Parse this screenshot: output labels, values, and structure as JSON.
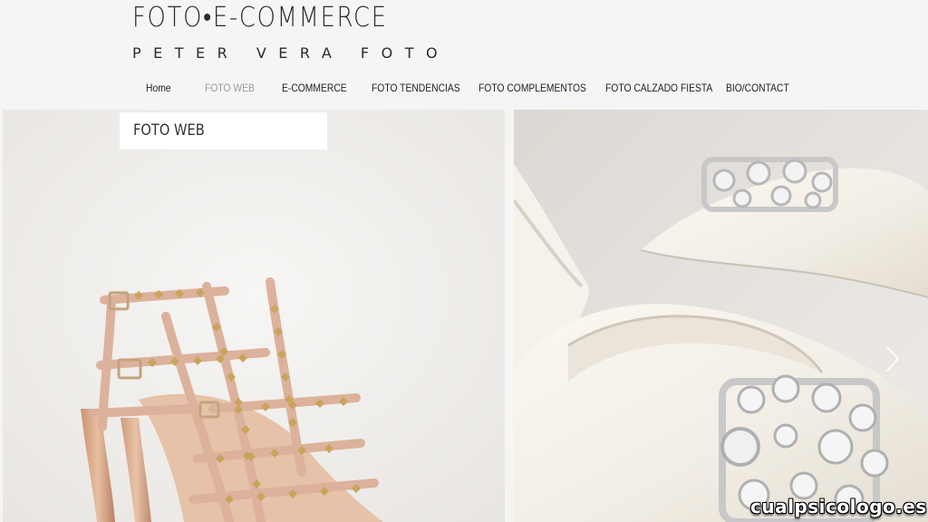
{
  "site": {
    "title": "FOTO•E-COMMERCE",
    "subtitle": "PETER VERA FOTO"
  },
  "nav": {
    "items": [
      {
        "label": "Home",
        "active": false
      },
      {
        "label": "FOTO WEB",
        "active": true
      },
      {
        "label": "E-COMMERCE",
        "active": false
      },
      {
        "label": "FOTO TENDENCIAS",
        "active": false
      },
      {
        "label": "FOTO COMPLEMENTOS",
        "active": false
      },
      {
        "label": "FOTO CALZADO FIESTA",
        "active": false
      },
      {
        "label": "BIO/CONTACT",
        "active": false
      }
    ]
  },
  "gallery": {
    "section_label": "FOTO WEB",
    "left_image": "studded-rose-gold-sandal-photo",
    "right_image": "ivory-jeweled-slingback-photo",
    "next_icon": "chevron-right-icon"
  },
  "watermark": "cualpsicologo.es",
  "colors": {
    "background": "#f5f5f5",
    "text": "#222222",
    "nav_active": "#9a9a9a",
    "sandal_strap": "#dcb29c",
    "stud_gold": "#c9a45c",
    "satin_ivory": "#f4f0e8"
  }
}
